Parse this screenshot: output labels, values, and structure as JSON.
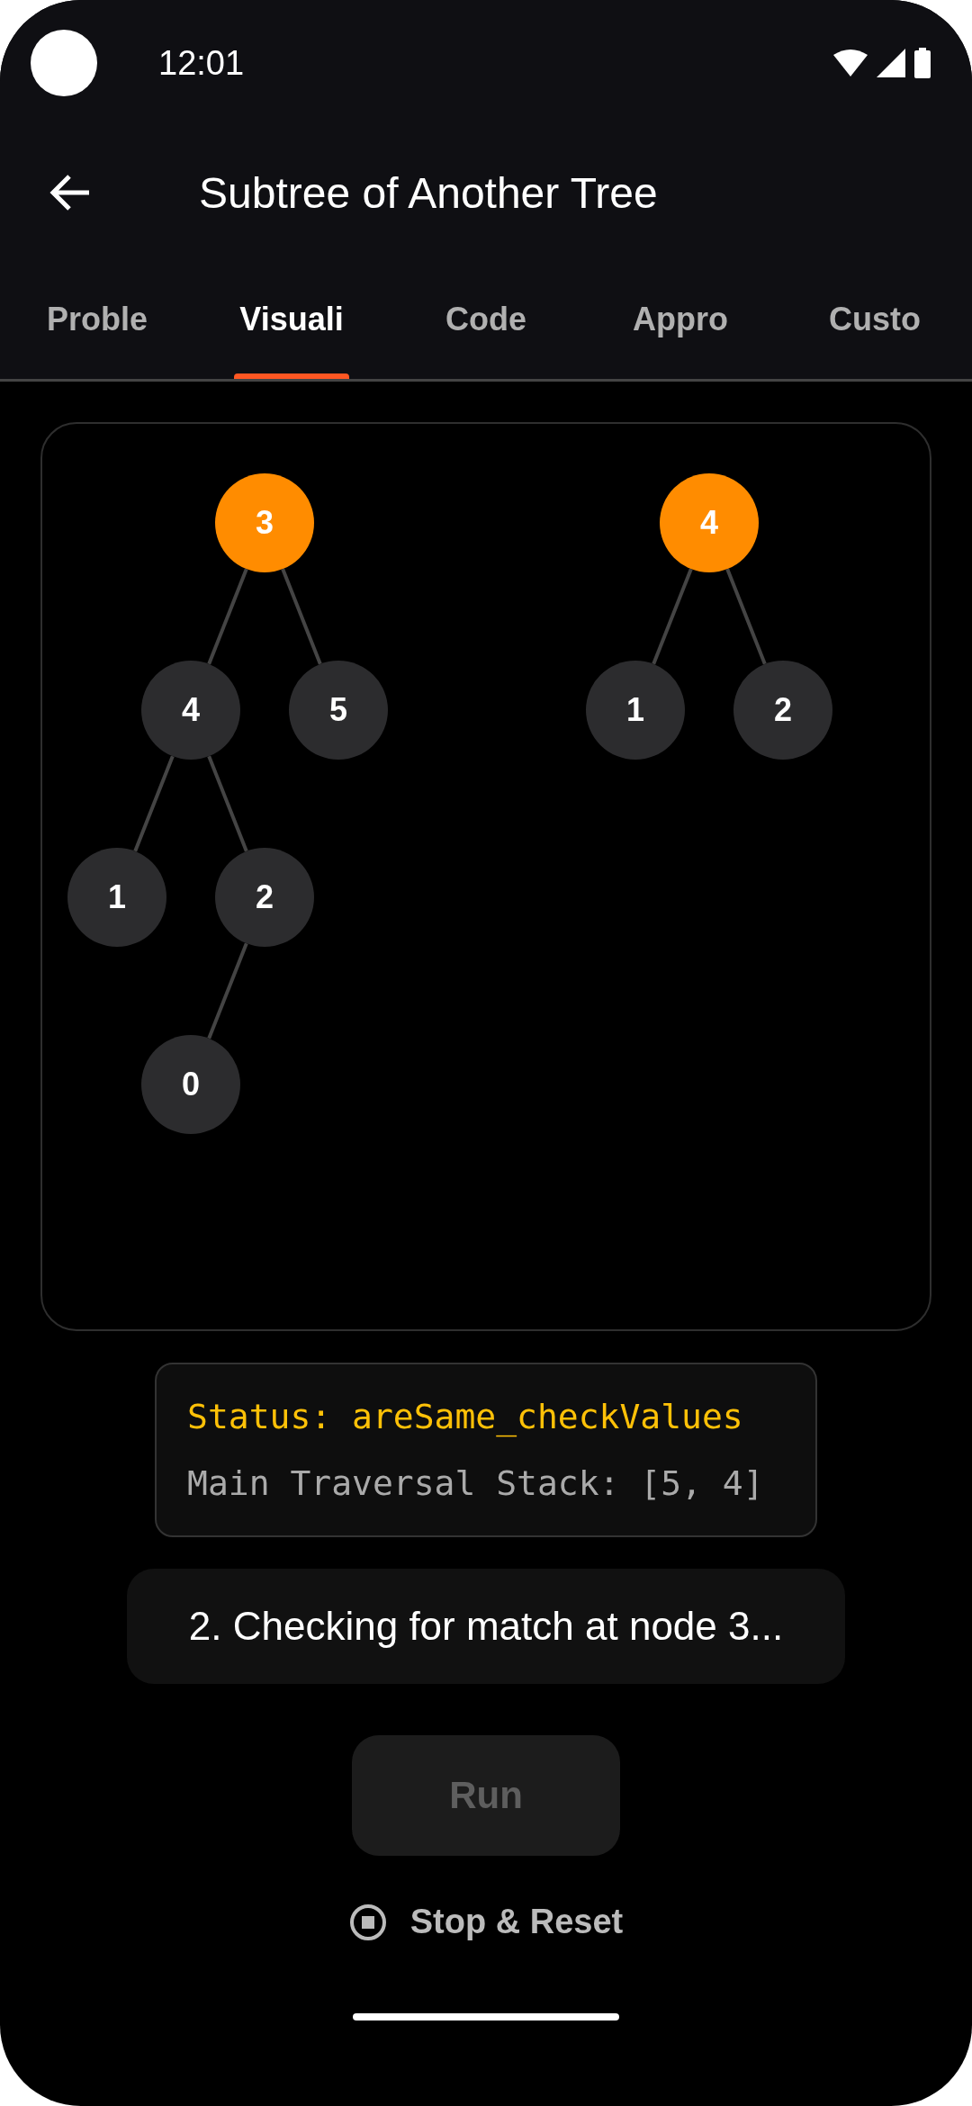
{
  "status_bar": {
    "time": "12:01"
  },
  "app_bar": {
    "title": "Subtree of Another Tree"
  },
  "tabs": [
    {
      "label": "Proble",
      "selected": false
    },
    {
      "label": "Visuali",
      "selected": true
    },
    {
      "label": "Code",
      "selected": false
    },
    {
      "label": "Appro",
      "selected": false
    },
    {
      "label": "Custo",
      "selected": false
    }
  ],
  "trees": [
    {
      "value": "3",
      "highlighted": true,
      "children": [
        {
          "value": "4",
          "highlighted": false,
          "children": [
            {
              "value": "1",
              "highlighted": false
            },
            {
              "value": "2",
              "highlighted": false,
              "children": [
                {
                  "value": "0",
                  "highlighted": false
                }
              ]
            }
          ]
        },
        {
          "value": "5",
          "highlighted": false
        }
      ]
    },
    {
      "value": "4",
      "highlighted": true,
      "children": [
        {
          "value": "1",
          "highlighted": false
        },
        {
          "value": "2",
          "highlighted": false
        }
      ]
    }
  ],
  "status_box": {
    "status": "Status: areSame_checkValues",
    "stack": "Main Traversal Stack: [5, 4]"
  },
  "message": "2. Checking for match at node 3...",
  "run_button": {
    "label": "Run",
    "disabled": true
  },
  "stop_button": {
    "label": "Stop & Reset"
  }
}
